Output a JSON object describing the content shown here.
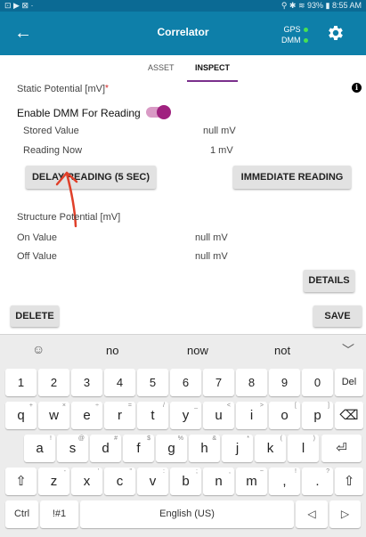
{
  "status_bar": {
    "left_icons": "⊡ ▶ ⊠ ·",
    "right_text": "⚲ ✱ ≋ 93% ▮ 8:55 AM"
  },
  "app_bar": {
    "title": "Correlator",
    "gps_label": "GPS",
    "dmm_label": "DMM",
    "status_color": "#47e054"
  },
  "tabs": [
    {
      "label": "ASSET",
      "active": false
    },
    {
      "label": "INSPECT",
      "active": true
    }
  ],
  "static_potential": {
    "label": "Static Potential [mV]",
    "required_marker": "*",
    "info_icon": "i",
    "enable_dmm_label": "Enable DMM For Reading",
    "enable_dmm_on": true,
    "stored_label": "Stored Value",
    "stored_value": "null mV",
    "reading_label": "Reading Now",
    "reading_value": "1 mV",
    "delay_button": "DELAY READING (5 SEC)",
    "immediate_button": "IMMEDIATE READING"
  },
  "structure_potential": {
    "label": "Structure Potential [mV]",
    "on_label": "On Value",
    "on_value": "null mV",
    "off_label": "Off Value",
    "off_value": "null mV",
    "details_button": "DETAILS"
  },
  "actions": {
    "delete": "DELETE",
    "save": "SAVE"
  },
  "keyboard": {
    "suggestions": [
      "no",
      "now",
      "not"
    ],
    "row1": [
      {
        "k": "1"
      },
      {
        "k": "2"
      },
      {
        "k": "3"
      },
      {
        "k": "4"
      },
      {
        "k": "5"
      },
      {
        "k": "6"
      },
      {
        "k": "7"
      },
      {
        "k": "8"
      },
      {
        "k": "9"
      },
      {
        "k": "0"
      },
      {
        "k": "Del"
      }
    ],
    "row2": [
      {
        "k": "q",
        "a": "+"
      },
      {
        "k": "w",
        "a": "×"
      },
      {
        "k": "e",
        "a": "÷"
      },
      {
        "k": "r",
        "a": "="
      },
      {
        "k": "t",
        "a": "/"
      },
      {
        "k": "y",
        "a": "_"
      },
      {
        "k": "u",
        "a": "<"
      },
      {
        "k": "i",
        "a": ">"
      },
      {
        "k": "o",
        "a": "["
      },
      {
        "k": "p",
        "a": "]"
      },
      {
        "k": "⌫",
        "a": ""
      }
    ],
    "row3": [
      {
        "k": "a",
        "a": "!"
      },
      {
        "k": "s",
        "a": "@"
      },
      {
        "k": "d",
        "a": "#"
      },
      {
        "k": "f",
        "a": "$"
      },
      {
        "k": "g",
        "a": "%"
      },
      {
        "k": "h",
        "a": "&"
      },
      {
        "k": "j",
        "a": "*"
      },
      {
        "k": "k",
        "a": "("
      },
      {
        "k": "l",
        "a": ")"
      },
      {
        "k": "⏎",
        "a": ""
      }
    ],
    "row4": [
      {
        "k": "⇧",
        "a": ""
      },
      {
        "k": "z",
        "a": "-"
      },
      {
        "k": "x",
        "a": "'"
      },
      {
        "k": "c",
        "a": "\""
      },
      {
        "k": "v",
        "a": ":"
      },
      {
        "k": "b",
        "a": ";"
      },
      {
        "k": "n",
        "a": ","
      },
      {
        "k": "m",
        "a": "~"
      },
      {
        "k": ",",
        "a": "!"
      },
      {
        "k": ".",
        "a": "?"
      },
      {
        "k": "⇧",
        "a": ""
      }
    ],
    "row5": [
      {
        "k": "Ctrl"
      },
      {
        "k": "!#1"
      },
      {
        "k": "English (US)"
      },
      {
        "k": "◁"
      },
      {
        "k": "▷"
      }
    ]
  },
  "accent_color": "#0e7fa9",
  "toggle_color": "#a0217f",
  "annotation_color": "#e0402a"
}
